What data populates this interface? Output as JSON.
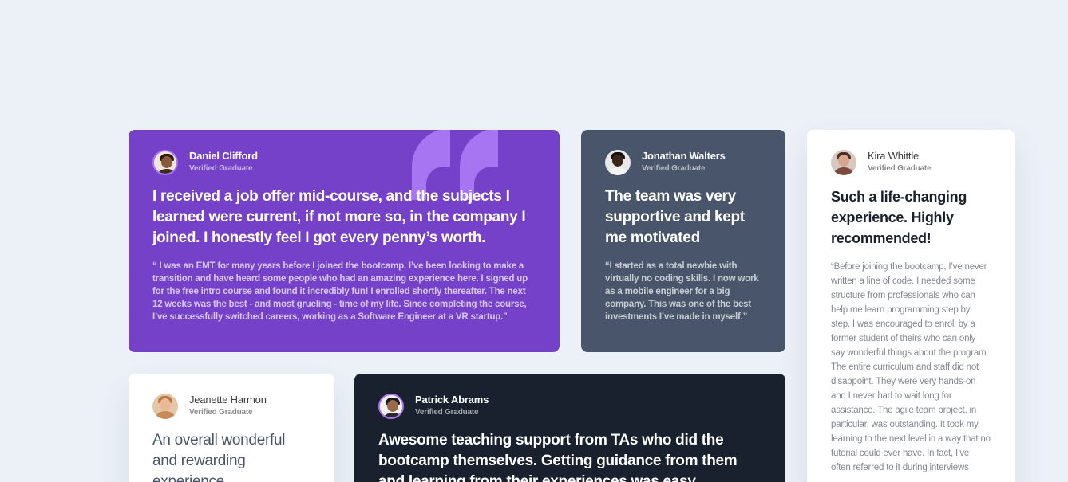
{
  "testimonials": [
    {
      "name": "Daniel Clifford",
      "role": "Verified Graduate",
      "headline": "I received a job offer mid-course, and the subjects I learned were current, if not more so, in the company I joined. I honestly feel I got every penny’s worth.",
      "quote": "“ I was an EMT for many years before I joined the bootcamp. I’ve been looking to make a transition and have heard some people who had an amazing experience here. I signed up for the free intro course and found it incredibly fun! I enrolled shortly thereafter. The next 12 weeks was the best - and most grueling - time of my life. Since completing the course, I’ve successfully switched careers, working as a Software Engineer at a VR startup.”",
      "bg_color": "#7541c8"
    },
    {
      "name": "Jonathan Walters",
      "role": "Verified Graduate",
      "headline": "The team was very supportive and kept me motivated",
      "quote": "“I started as a total newbie with virtually no coding skills. I now work as a mobile engineer for a big company. This was one of the best investments I’ve made in myself.”",
      "bg_color": "#48556a"
    },
    {
      "name": "Kira Whittle",
      "role": "Verified Graduate",
      "headline": "Such a life-changing experience. Highly recommended!",
      "quote": "“Before joining the bootcamp, I’ve never written a line of code. I needed some structure from professionals who can help me learn programming step by step. I was encouraged to enroll by a former student of theirs who can only say wonderful things about the program. The entire curriculum and staff did not disappoint. They were very hands-on and I never had to wait long for assistance. The agile team project, in particular, was outstanding. It took my learning to the next level in a way that no tutorial could ever have. In fact, I’ve often referred to it during interviews",
      "bg_color": "#ffffff"
    },
    {
      "name": "Jeanette Harmon",
      "role": "Verified Graduate",
      "headline": "An overall wonderful and rewarding experience",
      "quote": "",
      "bg_color": "#ffffff"
    },
    {
      "name": "Patrick Abrams",
      "role": "Verified Graduate",
      "headline": "Awesome teaching support from TAs who did the bootcamp themselves. Getting guidance from them and learning from their experiences was easy.",
      "quote": "",
      "bg_color": "#19212e"
    }
  ],
  "icons": {
    "quote_decoration": "quotation-mark-icon"
  },
  "colors": {
    "page_bg": "#ecf1f8",
    "quote_decoration": "#a775f1"
  }
}
